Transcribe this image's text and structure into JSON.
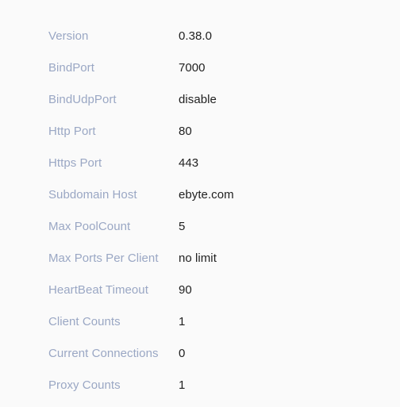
{
  "panel": {
    "name": "server-info",
    "background_color": "#fafafa",
    "label_color": "#9aa7c4",
    "value_color": "#1f1f1f"
  },
  "rows": [
    {
      "label": "Version",
      "value": "0.38.0"
    },
    {
      "label": "BindPort",
      "value": "7000"
    },
    {
      "label": "BindUdpPort",
      "value": "disable"
    },
    {
      "label": "Http Port",
      "value": "80"
    },
    {
      "label": "Https Port",
      "value": "443"
    },
    {
      "label": "Subdomain Host",
      "value": "ebyte.com"
    },
    {
      "label": "Max PoolCount",
      "value": "5"
    },
    {
      "label": "Max Ports Per Client",
      "value": "no limit"
    },
    {
      "label": "HeartBeat Timeout",
      "value": "90"
    },
    {
      "label": "Client Counts",
      "value": "1"
    },
    {
      "label": "Current Connections",
      "value": "0"
    },
    {
      "label": "Proxy Counts",
      "value": "1"
    }
  ]
}
